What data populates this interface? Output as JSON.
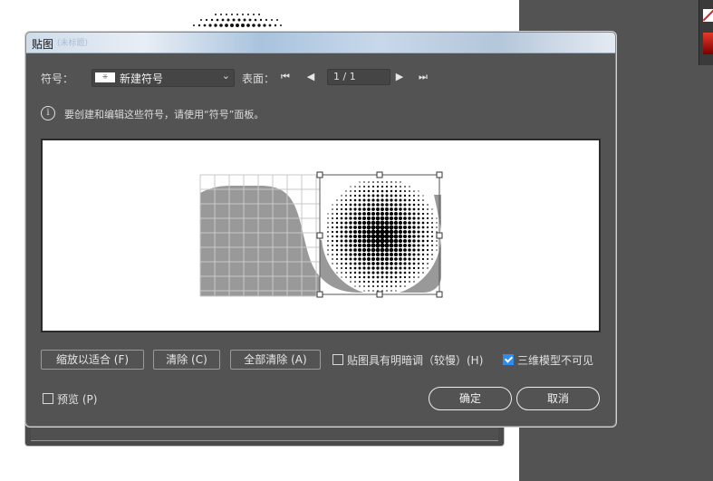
{
  "dialog": {
    "title": "贴图",
    "title_ghost": "(未标题)"
  },
  "symbol": {
    "label": "符号：",
    "thumb_glyph": "⁜",
    "selected": "新建符号",
    "chevron": "⌄"
  },
  "surface": {
    "label": "表面：",
    "first": "⏮",
    "prev": "◀",
    "page": "1 / 1",
    "next": "▶",
    "last": "⏭"
  },
  "info": {
    "icon": "i",
    "text": "要创建和编辑这些符号，请使用“符号”面板。"
  },
  "buttons": {
    "fit": "缩放以适合 (F)",
    "clear": "清除 (C)",
    "clear_all": "全部清除 (A)"
  },
  "options": {
    "shade_label": "贴图具有明暗调（较慢）(H)",
    "shade_checked": false,
    "invisible_label": "三维模型不可见",
    "invisible_checked": true,
    "preview_label": "预览 (P)",
    "preview_checked": false
  },
  "actions": {
    "ok": "确定",
    "cancel": "取消"
  },
  "colors": {
    "dialog_bg": "#535353",
    "checkbox_accent": "#2d8cf0",
    "surface_fill": "#999999",
    "preview_bg": "#ffffff"
  }
}
